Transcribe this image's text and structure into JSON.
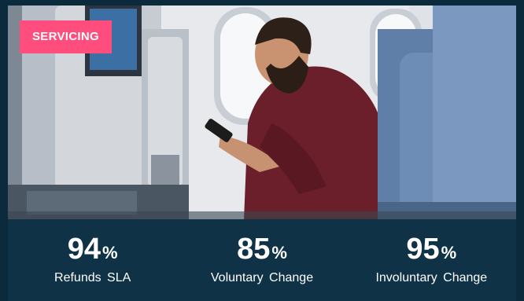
{
  "tag": {
    "label": "SERVICING"
  },
  "stats": [
    {
      "value": "94",
      "suffix": "%",
      "label": "Refunds SLA"
    },
    {
      "value": "85",
      "suffix": "%",
      "label": "Voluntary Change"
    },
    {
      "value": "95",
      "suffix": "%",
      "label": "Involuntary Change"
    }
  ],
  "colors": {
    "background": "#0f3246",
    "tag": "#ff4d7d",
    "text": "#ffffff"
  }
}
